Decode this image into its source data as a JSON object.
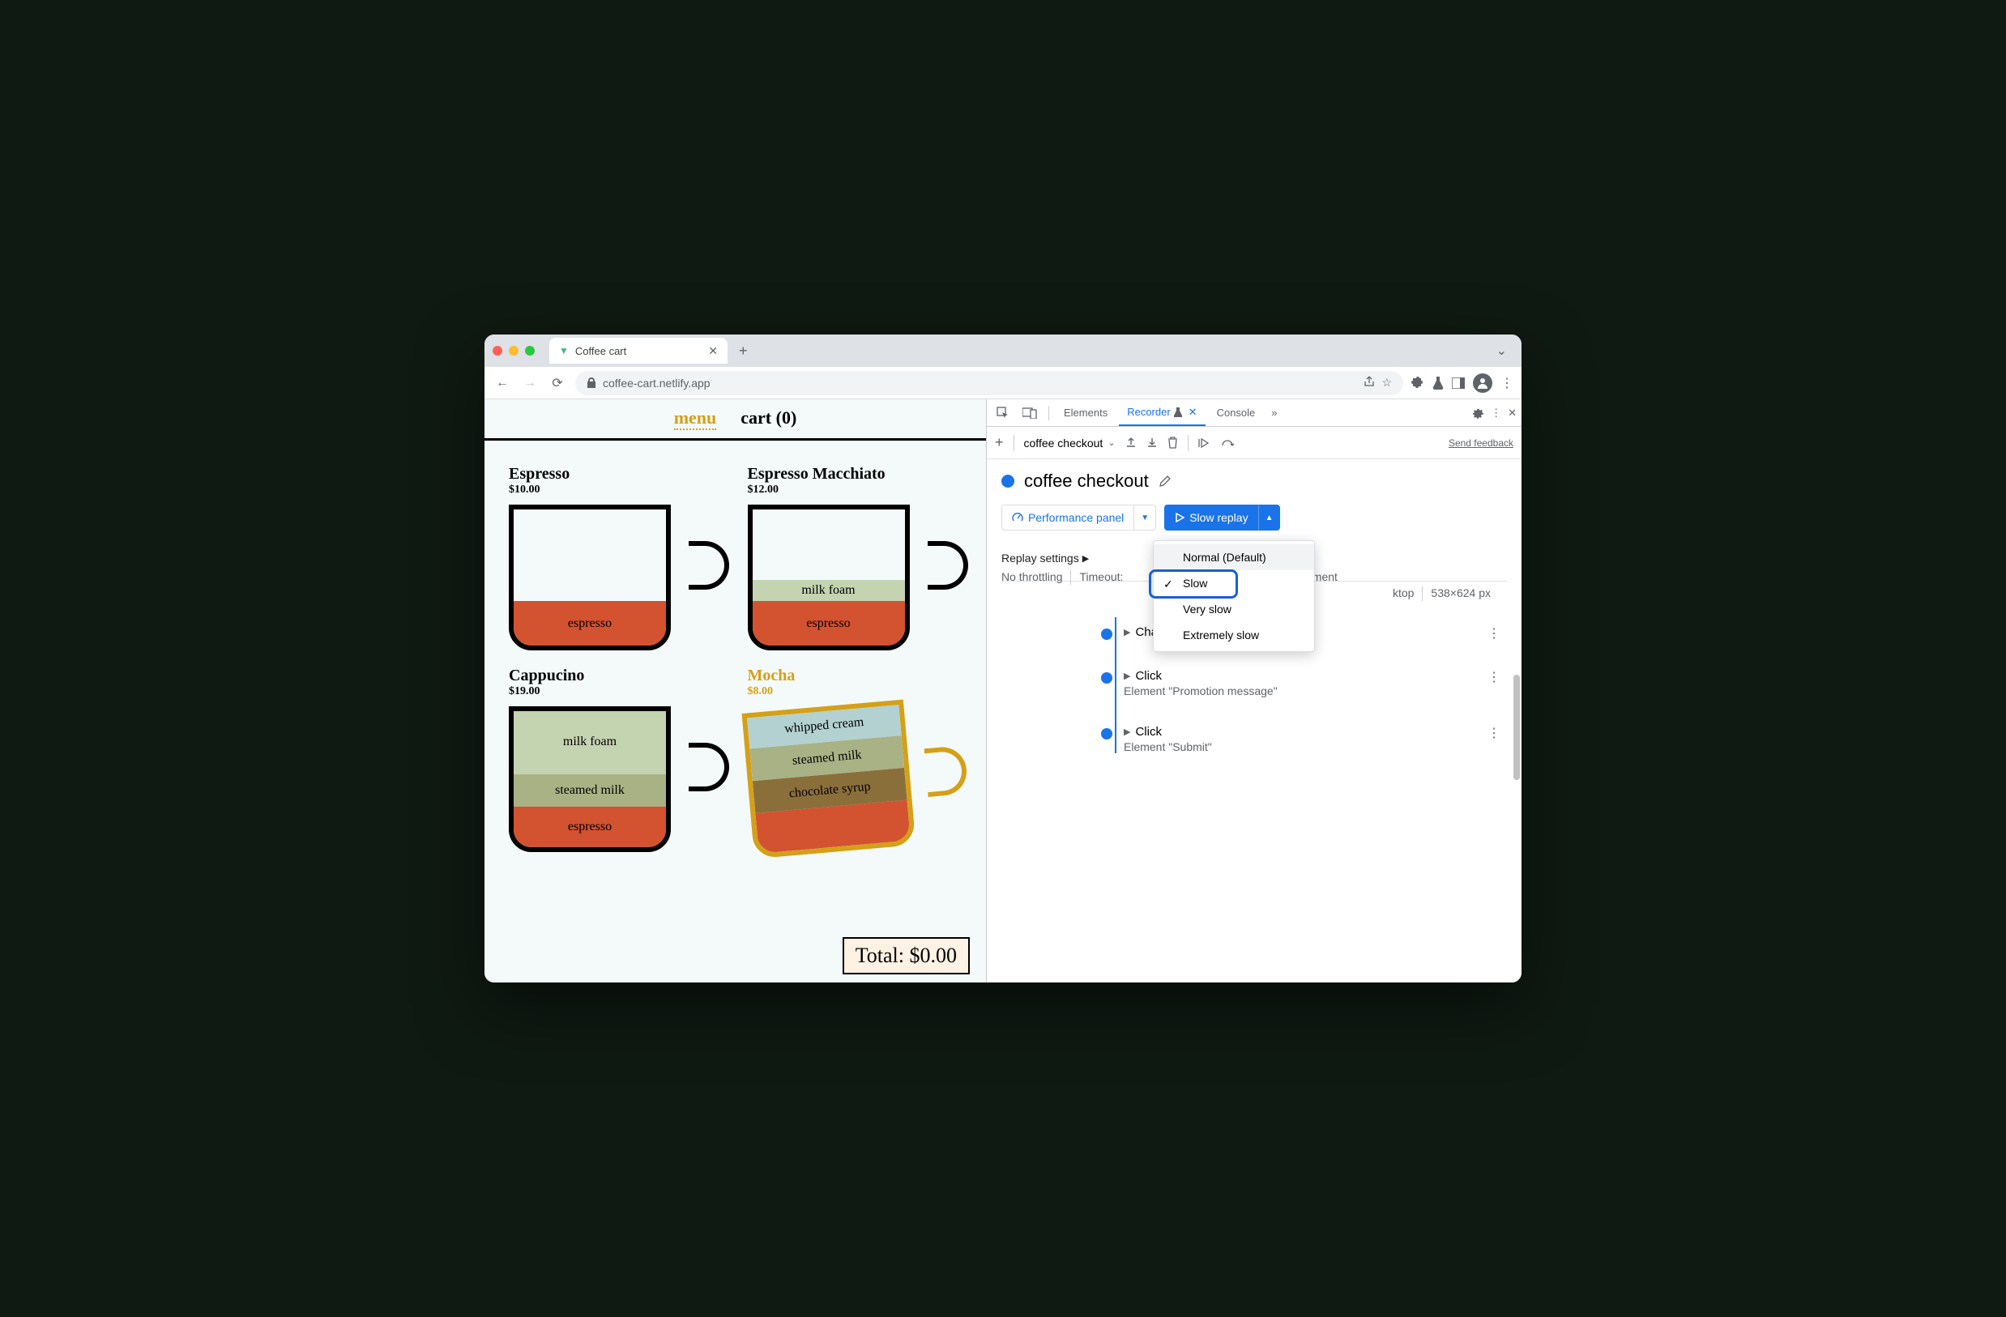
{
  "browser": {
    "tab_title": "Coffee cart",
    "url": "coffee-cart.netlify.app"
  },
  "page": {
    "nav": {
      "menu": "menu",
      "cart": "cart (0)"
    },
    "items": [
      {
        "name": "Espresso",
        "price": "$10.00"
      },
      {
        "name": "Espresso Macchiato",
        "price": "$12.00"
      },
      {
        "name": "Cappucino",
        "price": "$19.00"
      },
      {
        "name": "Mocha",
        "price": "$8.00"
      }
    ],
    "layers": {
      "espresso": "espresso",
      "milk_foam": "milk foam",
      "steamed_milk": "steamed milk",
      "chocolate_syrup": "chocolate syrup",
      "whipped_cream": "whipped cream"
    },
    "total": "Total: $0.00"
  },
  "devtools": {
    "tabs": {
      "elements": "Elements",
      "recorder": "Recorder",
      "console": "Console"
    },
    "recorder": {
      "recording_name_short": "coffee checkout",
      "recording_name": "coffee checkout",
      "send_feedback": "Send feedback",
      "perf_button": "Performance panel",
      "replay_button": "Slow replay",
      "speed_options": {
        "normal": "Normal (Default)",
        "slow": "Slow",
        "very_slow": "Very slow",
        "extremely_slow": "Extremely slow"
      },
      "settings": {
        "label": "Replay settings",
        "throttling": "No throttling",
        "timeout_label": "Timeout:",
        "environment_partial": "ironment",
        "viewport_partial": "ktop",
        "dimensions": "538×624 px"
      },
      "steps": [
        {
          "action": "Change",
          "detail": ""
        },
        {
          "action": "Click",
          "detail": "Element \"Promotion message\""
        },
        {
          "action": "Click",
          "detail": "Element \"Submit\""
        }
      ]
    }
  }
}
